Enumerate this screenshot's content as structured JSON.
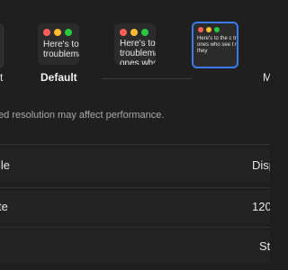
{
  "display": {
    "thumbnails": [
      {
        "label": "xt",
        "selected": false
      },
      {
        "label": "Default",
        "selected": false,
        "preview_text": "Here's to t troublemake"
      },
      {
        "label": "",
        "selected": false,
        "preview_text": "Here's to t troublema ones who"
      },
      {
        "label": "M",
        "selected": true,
        "preview_text": "Here's to the c troublemakers ones who see t rules. And they"
      }
    ],
    "notice": "ed resolution may affect performance."
  },
  "rows": [
    {
      "left": "ile",
      "right": "Disp"
    },
    {
      "left": "te",
      "right": "120"
    },
    {
      "left": "",
      "right": "St"
    }
  ],
  "colors": {
    "red": "#ff5f57",
    "yellow": "#febc2e",
    "green": "#28c840",
    "accent": "#3a7af0",
    "background": "#1f1f1f"
  }
}
